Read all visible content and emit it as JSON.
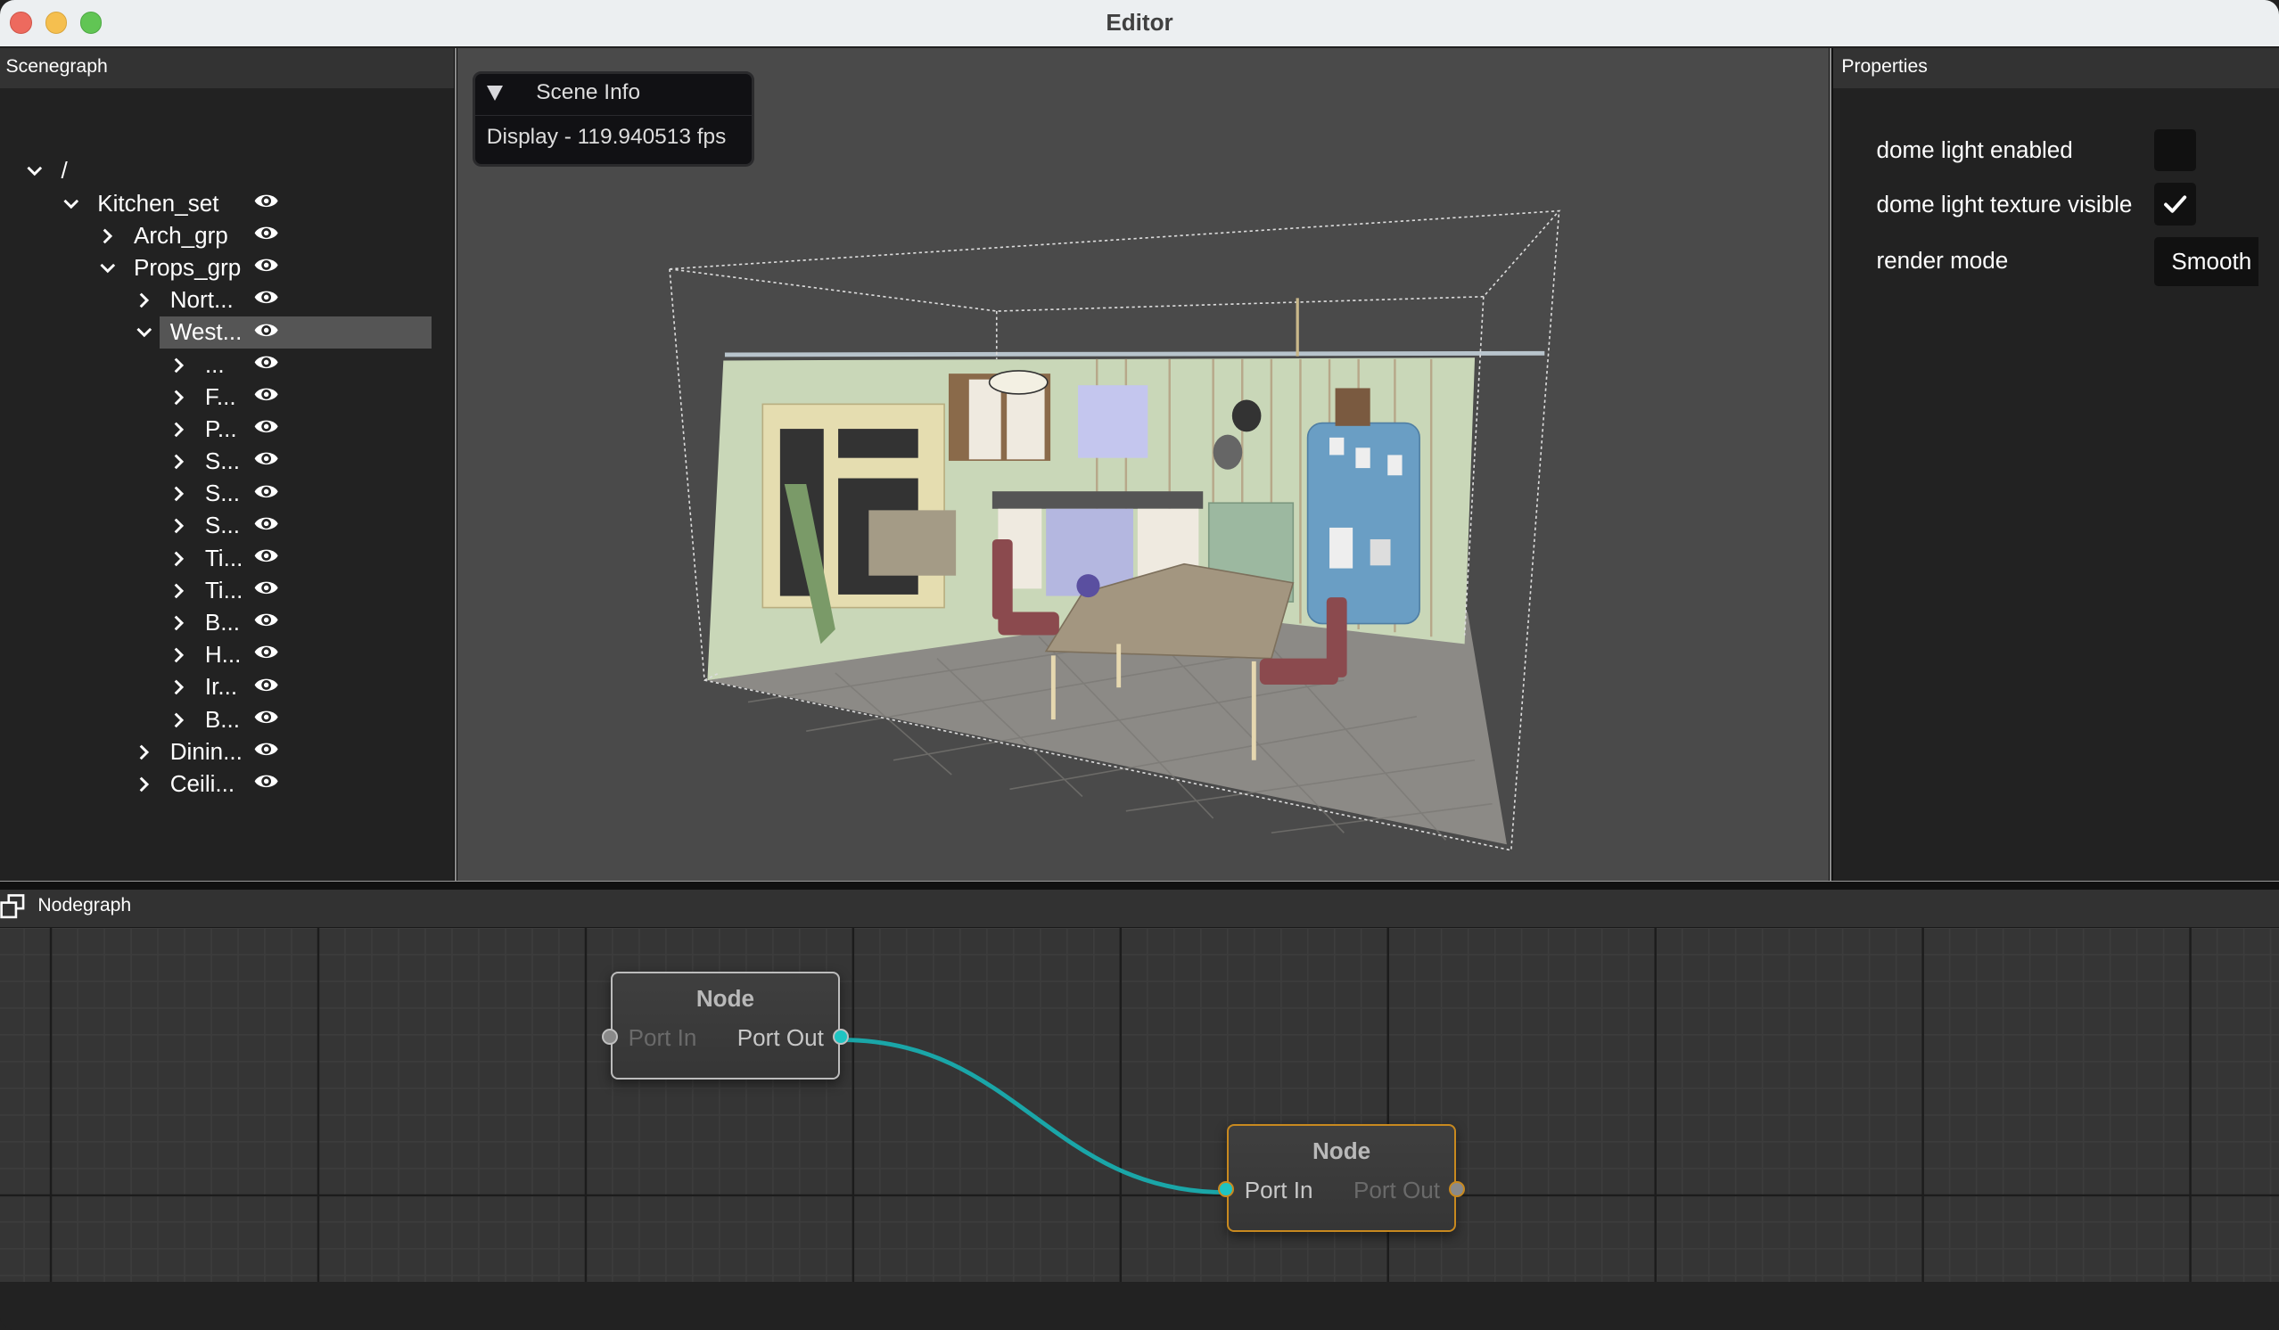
{
  "window": {
    "title": "Editor",
    "controls": [
      "close",
      "minimize",
      "maximize"
    ]
  },
  "scenegraph": {
    "title": "Scenegraph",
    "tree": [
      {
        "label": "/",
        "depth": 0,
        "expanded": true,
        "visible_icon": false,
        "selected": false
      },
      {
        "label": "Kitchen_set",
        "depth": 1,
        "expanded": true,
        "visible_icon": true,
        "selected": false
      },
      {
        "label": "Arch_grp",
        "depth": 2,
        "expanded": false,
        "visible_icon": true,
        "selected": false
      },
      {
        "label": "Props_grp",
        "depth": 2,
        "expanded": true,
        "visible_icon": true,
        "selected": false
      },
      {
        "label": "Nort...",
        "depth": 3,
        "expanded": false,
        "visible_icon": true,
        "selected": false
      },
      {
        "label": "West...",
        "depth": 3,
        "expanded": true,
        "visible_icon": true,
        "selected": true
      },
      {
        "label": "...",
        "depth": 4,
        "expanded": false,
        "visible_icon": true,
        "selected": false
      },
      {
        "label": "F...",
        "depth": 4,
        "expanded": false,
        "visible_icon": true,
        "selected": false
      },
      {
        "label": "P...",
        "depth": 4,
        "expanded": false,
        "visible_icon": true,
        "selected": false
      },
      {
        "label": "S...",
        "depth": 4,
        "expanded": false,
        "visible_icon": true,
        "selected": false
      },
      {
        "label": "S...",
        "depth": 4,
        "expanded": false,
        "visible_icon": true,
        "selected": false
      },
      {
        "label": "S...",
        "depth": 4,
        "expanded": false,
        "visible_icon": true,
        "selected": false
      },
      {
        "label": "Ti...",
        "depth": 4,
        "expanded": false,
        "visible_icon": true,
        "selected": false
      },
      {
        "label": "Ti...",
        "depth": 4,
        "expanded": false,
        "visible_icon": true,
        "selected": false
      },
      {
        "label": "B...",
        "depth": 4,
        "expanded": false,
        "visible_icon": true,
        "selected": false
      },
      {
        "label": "H...",
        "depth": 4,
        "expanded": false,
        "visible_icon": true,
        "selected": false
      },
      {
        "label": "Ir...",
        "depth": 4,
        "expanded": false,
        "visible_icon": true,
        "selected": false
      },
      {
        "label": "B...",
        "depth": 4,
        "expanded": false,
        "visible_icon": true,
        "selected": false
      },
      {
        "label": "Dinin...",
        "depth": 3,
        "expanded": false,
        "visible_icon": true,
        "selected": false
      },
      {
        "label": "Ceili...",
        "depth": 3,
        "expanded": false,
        "visible_icon": true,
        "selected": false
      }
    ]
  },
  "viewport": {
    "scene_info": {
      "title": "Scene Info",
      "expanded": true,
      "fps_text": "Display - 119.940513 fps"
    },
    "content": "3D kitchen scene render with bounding box"
  },
  "properties": {
    "title": "Properties",
    "items": [
      {
        "label": "dome light enabled",
        "type": "checkbox",
        "checked": false
      },
      {
        "label": "dome light texture visible",
        "type": "checkbox",
        "checked": true
      },
      {
        "label": "render mode",
        "type": "dropdown",
        "value": "Smooth"
      }
    ]
  },
  "nodegraph": {
    "title": "Nodegraph",
    "icon": "windows-restore-icon",
    "nodes": [
      {
        "title": "Node",
        "port_in": "Port In",
        "port_out": "Port Out",
        "in_connected": false,
        "out_connected": true,
        "selected": false
      },
      {
        "title": "Node",
        "port_in": "Port In",
        "port_out": "Port Out",
        "in_connected": true,
        "out_connected": false,
        "selected": true
      }
    ],
    "link_color": "#1aa6a8",
    "connected_port_color": "#1fc4c2",
    "unconnected_port_color": "#8a8a8a",
    "selected_border_color": "#c8891f"
  }
}
